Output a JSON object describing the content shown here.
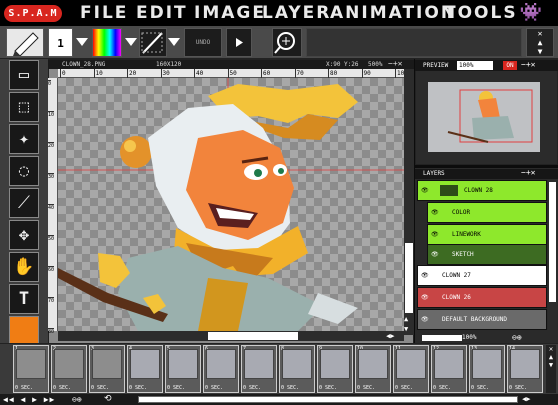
{
  "app": {
    "logo": "S.P.A.M"
  },
  "menu": [
    "FILE",
    "EDIT",
    "IMAGE",
    "LAYER",
    "ANIMATION",
    "TOOLS"
  ],
  "toolbar": {
    "brush_size": "1",
    "undo_label": "UNDO"
  },
  "canvas": {
    "filename": "CLOWN_28.PNG",
    "dimensions": "160X120",
    "coords": "X:90 Y:26",
    "zoom": "500%",
    "ruler_ticks": [
      "0",
      "10",
      "20",
      "30",
      "40",
      "50",
      "60",
      "70",
      "80",
      "90",
      "100"
    ],
    "vruler_ticks": [
      "0",
      "10",
      "20",
      "30",
      "40",
      "50",
      "60",
      "70",
      "80"
    ]
  },
  "preview": {
    "title": "PREVIEW",
    "zoom": "100%",
    "toggle": "ON"
  },
  "layers": {
    "title": "LAYERS",
    "items": [
      {
        "name": "CLOWN 28",
        "style": "group"
      },
      {
        "name": "COLOR",
        "style": "sub"
      },
      {
        "name": "LINEWORK",
        "style": "sub"
      },
      {
        "name": "SKETCH",
        "style": "subdark"
      },
      {
        "name": "CLOWN 27",
        "style": "white"
      },
      {
        "name": "CLOWN 26",
        "style": "red"
      },
      {
        "name": "DEFAULT BACKGROUND",
        "style": "gray"
      }
    ],
    "opacity": "100%"
  },
  "frames": {
    "count": 14,
    "duration_label": "0 SEC.",
    "numbers": [
      "1",
      "2",
      "3",
      "4",
      "5",
      "6",
      "7",
      "8",
      "9",
      "10",
      "11",
      "12",
      "13",
      "14"
    ]
  },
  "colors": {
    "accent_red": "#d8261f",
    "layer_green": "#8ee82c",
    "layer_red": "#c84545",
    "foreground": "#f07d14"
  }
}
